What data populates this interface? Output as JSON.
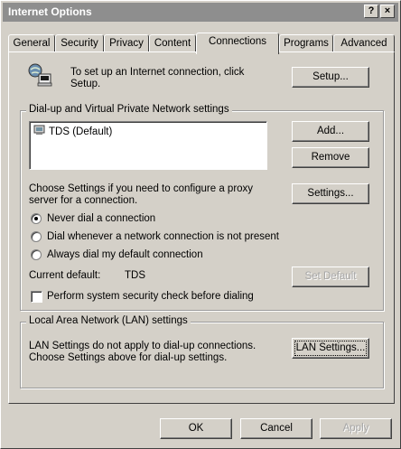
{
  "window": {
    "title": "Internet Options",
    "help_label": "?",
    "close_label": "×"
  },
  "tabs": [
    {
      "label": "General"
    },
    {
      "label": "Security"
    },
    {
      "label": "Privacy"
    },
    {
      "label": "Content"
    },
    {
      "label": "Connections",
      "active": true
    },
    {
      "label": "Programs"
    },
    {
      "label": "Advanced"
    }
  ],
  "setup": {
    "text_line1": "To set up an Internet connection, click",
    "text_line2": "Setup.",
    "button": "Setup..."
  },
  "dialup": {
    "group_label": "Dial-up and Virtual Private Network settings",
    "list_items": [
      "TDS (Default)"
    ],
    "add_button": "Add...",
    "remove_button": "Remove",
    "settings_text_line1": "Choose Settings if you need to configure a proxy",
    "settings_text_line2": "server for a connection.",
    "settings_button": "Settings...",
    "radio_options": [
      {
        "label": "Never dial a connection",
        "checked": true
      },
      {
        "label": "Dial whenever a network connection is not present",
        "checked": false
      },
      {
        "label": "Always dial my default connection",
        "checked": false
      }
    ],
    "current_default_label": "Current default:",
    "current_default_value": "TDS",
    "set_default_button": "Set Default",
    "security_check_label": "Perform system security check before dialing",
    "security_check_checked": false
  },
  "lan": {
    "group_label": "Local Area Network (LAN) settings",
    "text_line1": "LAN Settings do not apply to dial-up connections.",
    "text_line2": "Choose Settings above for dial-up settings.",
    "button": "LAN Settings..."
  },
  "footer": {
    "ok": "OK",
    "cancel": "Cancel",
    "apply": "Apply"
  }
}
